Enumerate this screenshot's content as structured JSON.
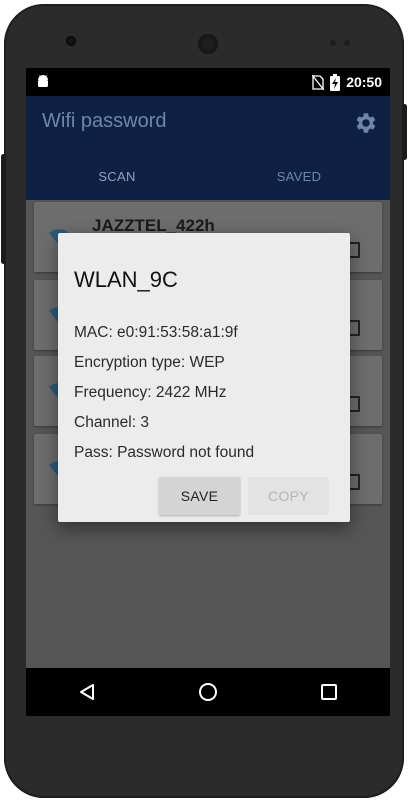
{
  "status_bar": {
    "time": "20:50",
    "icons": [
      "android-icon",
      "no-sim-icon",
      "battery-charging-icon"
    ]
  },
  "app_bar": {
    "title": "Wifi password",
    "settings_icon": "gear-icon"
  },
  "tabs": [
    {
      "label": "SCAN",
      "active": true
    },
    {
      "label": "SAVED",
      "active": false
    }
  ],
  "networks": [
    {
      "ssid": "JAZZTEL_422h"
    }
  ],
  "dialog": {
    "title": "WLAN_9C",
    "mac": "MAC: e0:91:53:58:a1:9f",
    "encryption": "Encryption type: WEP",
    "frequency": "Frequency: 2422 MHz",
    "channel": "Channel: 3",
    "pass": "Pass: Password not found",
    "save_label": "SAVE",
    "copy_label": "COPY"
  },
  "colors": {
    "app_bar": "#0f2142",
    "dialog_bg": "#ececec",
    "overlay": "#565656"
  }
}
